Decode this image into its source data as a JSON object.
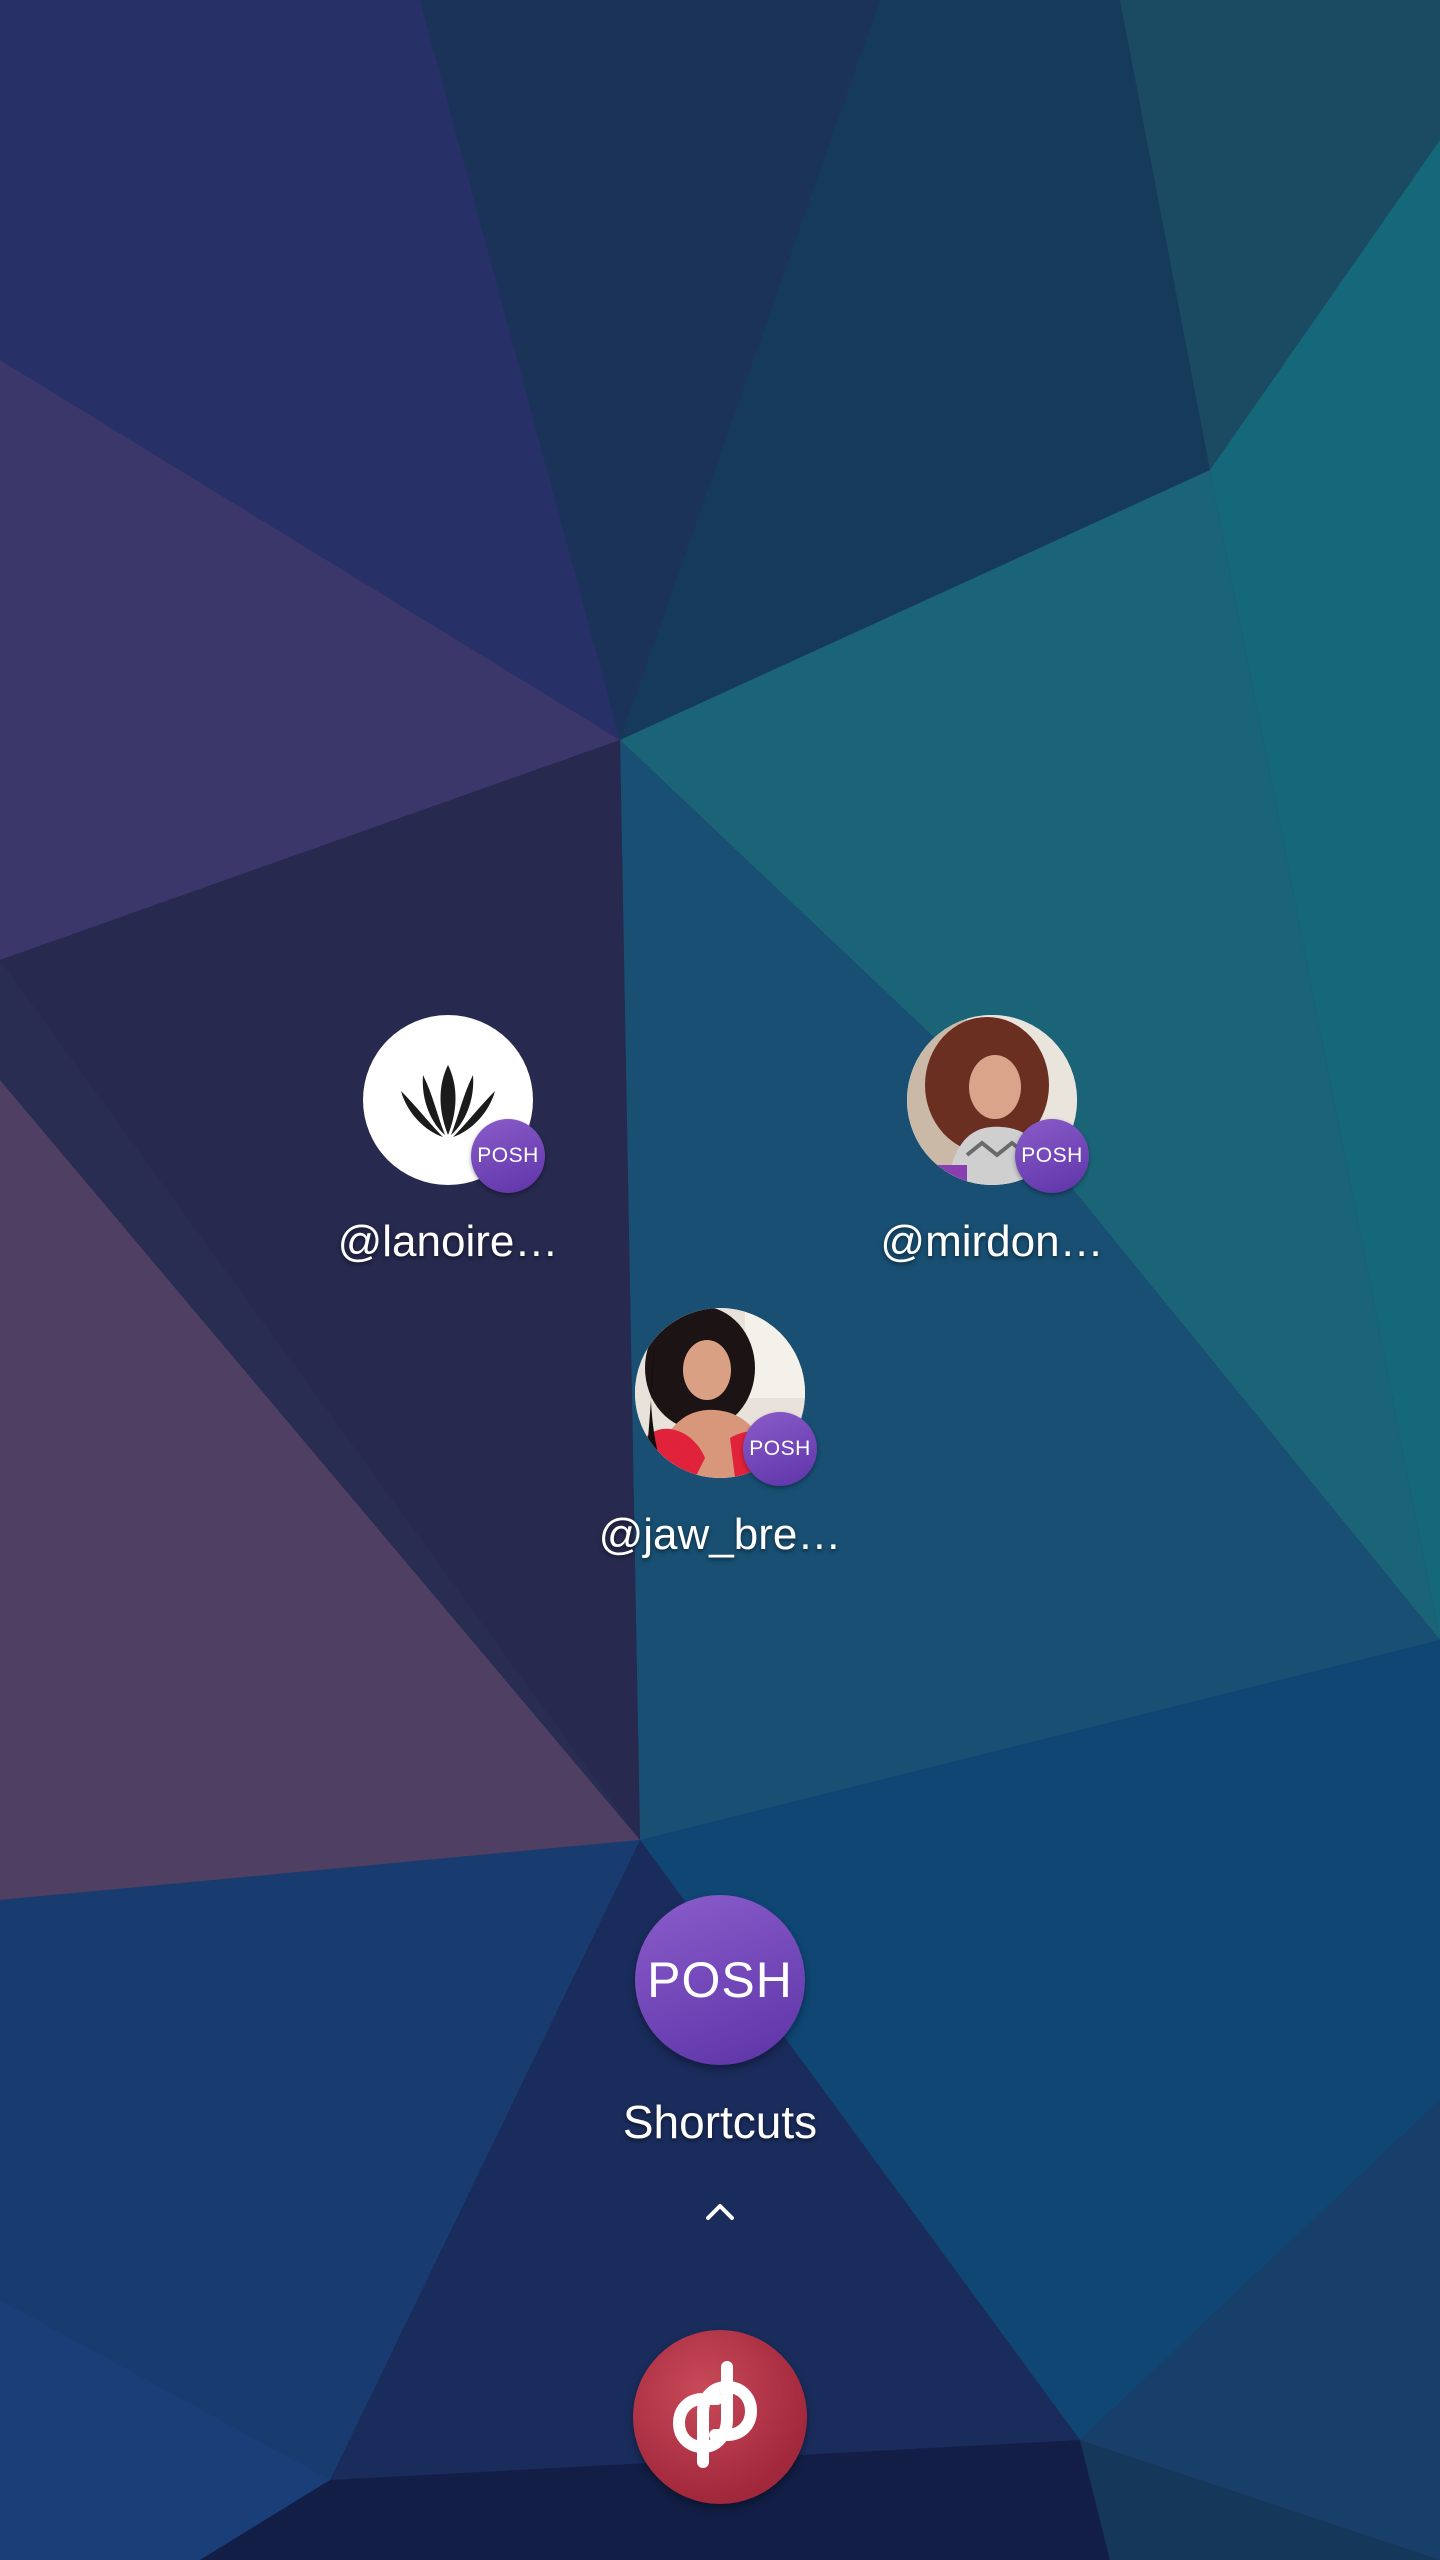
{
  "shortcuts": [
    {
      "label": "@lanoire…",
      "badge": "POSH",
      "avatar": "lotus-logo"
    },
    {
      "label": "@mirdon…",
      "badge": "POSH",
      "avatar": "profile-photo-woman-curly-hair"
    },
    {
      "label": "@jaw_bre…",
      "badge": "POSH",
      "avatar": "profile-photo-woman-red-top"
    }
  ],
  "folder": {
    "icon_text": "POSH",
    "label": "Shortcuts"
  },
  "chevron": {
    "icon": "chevron-up-icon"
  },
  "app": {
    "icon": "poshmark-app-icon"
  },
  "colors": {
    "badge_purple": "#6c3fb4",
    "app_red": "#a82c40",
    "label_white": "#ffffff"
  }
}
